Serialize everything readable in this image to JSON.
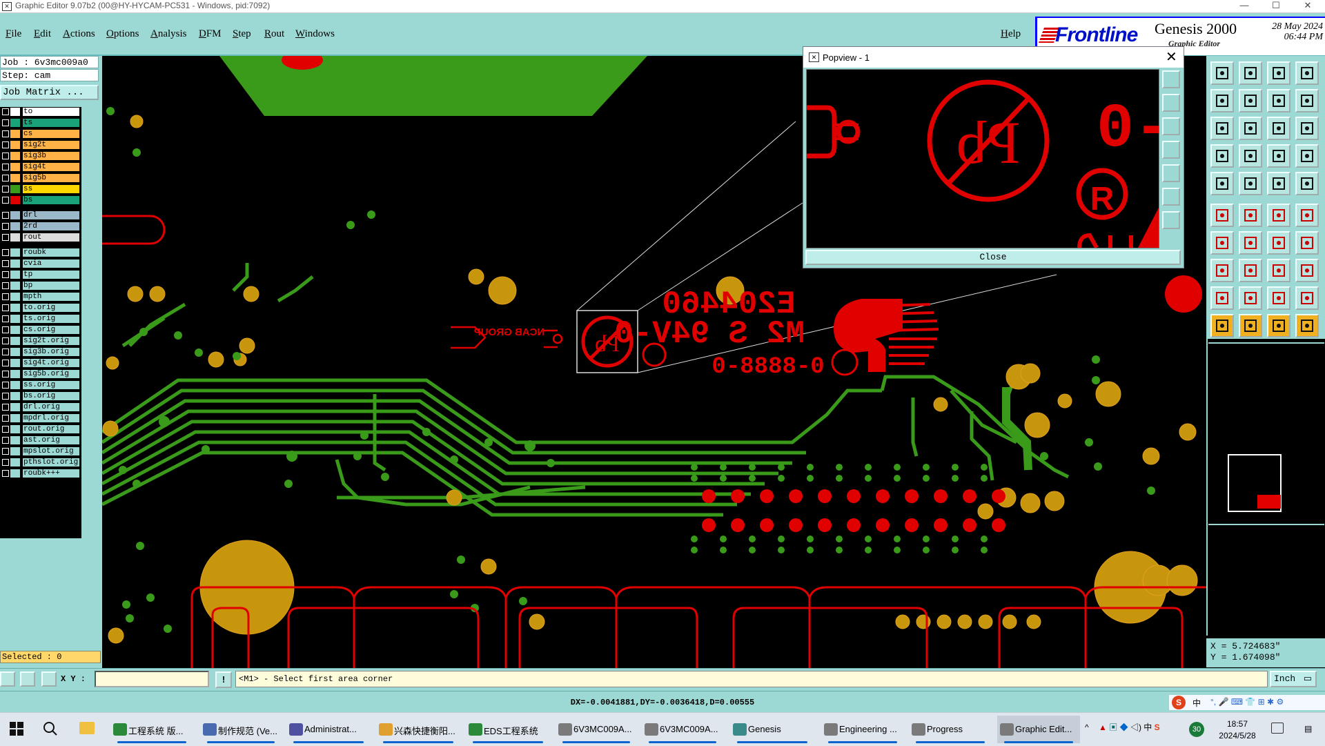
{
  "window": {
    "title": "Graphic Editor 9.07b2 (00@HY-HYCAM-PC531 - Windows, pid:7092)",
    "controls": [
      "—",
      "☐",
      "✕"
    ]
  },
  "menu": [
    "File",
    "Edit",
    "Actions",
    "Options",
    "Analysis",
    "DFM",
    "Step",
    "Rout",
    "Windows"
  ],
  "help_label": "Help",
  "logo": {
    "brand": "Frontline",
    "product": "Genesis 2000",
    "subtitle": "Graphic Editor",
    "date": "28 May 2024",
    "time": "06:44 PM"
  },
  "job_info": {
    "job": "Job : 6v3mc009a0",
    "step": "Step: cam",
    "matrix_button": "Job Matrix ..."
  },
  "layers": [
    {
      "name": "to",
      "color": "#ffffff",
      "swatch": "#ffffff"
    },
    {
      "name": "ts",
      "color": "#1aa37a",
      "swatch": "#1aa37a"
    },
    {
      "name": "cs",
      "color": "#ffb347",
      "swatch": "#ffb347"
    },
    {
      "name": "sig2t",
      "color": "#ffb347",
      "swatch": "#ffb347"
    },
    {
      "name": "sig3b",
      "color": "#ffb347",
      "swatch": "#ffb347"
    },
    {
      "name": "sig4t",
      "color": "#ffb347",
      "swatch": "#ffb347"
    },
    {
      "name": "sig5b",
      "color": "#ffb347",
      "swatch": "#ffb347"
    },
    {
      "name": "ss",
      "color": "#ffd700",
      "swatch": "#3a9a1a"
    },
    {
      "name": "bs",
      "color": "#1aa37a",
      "swatch": "#e00000"
    },
    {
      "name": "drl",
      "color": "#9bb8c8",
      "swatch": "#9bb8c8"
    },
    {
      "name": "2rd",
      "color": "#9bb8c8",
      "swatch": "#9bb8c8"
    },
    {
      "name": "rout",
      "color": "#dcdcdc",
      "swatch": "#dcdcdc"
    },
    {
      "name": "roubk",
      "color": "#9dd9d4",
      "swatch": "#9dd9d4"
    },
    {
      "name": "cvia",
      "color": "#9dd9d4",
      "swatch": "#9dd9d4"
    },
    {
      "name": "tp",
      "color": "#9dd9d4",
      "swatch": "#9dd9d4"
    },
    {
      "name": "bp",
      "color": "#9dd9d4",
      "swatch": "#9dd9d4"
    },
    {
      "name": "mpth",
      "color": "#9dd9d4",
      "swatch": "#9dd9d4"
    },
    {
      "name": "to.orig",
      "color": "#9dd9d4",
      "swatch": "#9dd9d4"
    },
    {
      "name": "ts.orig",
      "color": "#9dd9d4",
      "swatch": "#9dd9d4"
    },
    {
      "name": "cs.orig",
      "color": "#9dd9d4",
      "swatch": "#9dd9d4"
    },
    {
      "name": "sig2t.orig",
      "color": "#9dd9d4",
      "swatch": "#9dd9d4"
    },
    {
      "name": "sig3b.orig",
      "color": "#9dd9d4",
      "swatch": "#9dd9d4"
    },
    {
      "name": "sig4t.orig",
      "color": "#9dd9d4",
      "swatch": "#9dd9d4"
    },
    {
      "name": "sig5b.orig",
      "color": "#9dd9d4",
      "swatch": "#9dd9d4"
    },
    {
      "name": "ss.orig",
      "color": "#9dd9d4",
      "swatch": "#9dd9d4"
    },
    {
      "name": "bs.orig",
      "color": "#9dd9d4",
      "swatch": "#9dd9d4"
    },
    {
      "name": "drl.orig",
      "color": "#9dd9d4",
      "swatch": "#9dd9d4"
    },
    {
      "name": "mpdrl.orig",
      "color": "#9dd9d4",
      "swatch": "#9dd9d4"
    },
    {
      "name": "rout.orig",
      "color": "#9dd9d4",
      "swatch": "#9dd9d4"
    },
    {
      "name": "ast.orig",
      "color": "#9dd9d4",
      "swatch": "#9dd9d4"
    },
    {
      "name": "mpslot.orig",
      "color": "#9dd9d4",
      "swatch": "#9dd9d4"
    },
    {
      "name": "pthslot.orig",
      "color": "#9dd9d4",
      "swatch": "#9dd9d4"
    },
    {
      "name": "roubk+++",
      "color": "#9dd9d4",
      "swatch": "#9dd9d4"
    }
  ],
  "selected_label": "Selected : 0",
  "canvas_marking": {
    "part_number": "E204460",
    "rating": "M2 S 94V-0",
    "code": "0-8888-0",
    "logo_text": "NCAB GROUP",
    "pb_symbol": "Pb"
  },
  "popview": {
    "title": "Popview - 1",
    "close_label": "Close",
    "pb_symbol": "Pb",
    "reg_symbol": "R"
  },
  "coordinates": {
    "x": "X = 5.724683\"",
    "y": "Y = 1.674098\""
  },
  "command": {
    "xy_label": "X Y :",
    "xy_value": "",
    "prompt": "<M1> - Select first area corner",
    "units": "Inch"
  },
  "status": "DX=-0.0041881,DY=-0.0036418,D=0.00555",
  "ime": {
    "lang": "中"
  },
  "taskbar": {
    "items": [
      {
        "label": "工程系统  版...",
        "color": "#2a8a3a"
      },
      {
        "label": "制作规范 (Ve...",
        "color": "#4a6ab0"
      },
      {
        "label": "Administrat...",
        "color": "#5050a0"
      },
      {
        "label": "兴森快捷衡阳...",
        "color": "#e0a030"
      },
      {
        "label": "EDS工程系统",
        "color": "#2a8a3a"
      },
      {
        "label": "6V3MC009A...",
        "color": "#7a7a7a"
      },
      {
        "label": "6V3MC009A...",
        "color": "#7a7a7a"
      },
      {
        "label": "Genesis",
        "color": "#3a8a8a"
      },
      {
        "label": "Engineering ...",
        "color": "#7a7a7a"
      },
      {
        "label": "Progress",
        "color": "#7a7a7a"
      },
      {
        "label": "Graphic Edit...",
        "color": "#7a7a7a"
      }
    ],
    "tray_lang": "中",
    "tray_count": "30",
    "time": "18:57",
    "date": "2024/5/28"
  }
}
